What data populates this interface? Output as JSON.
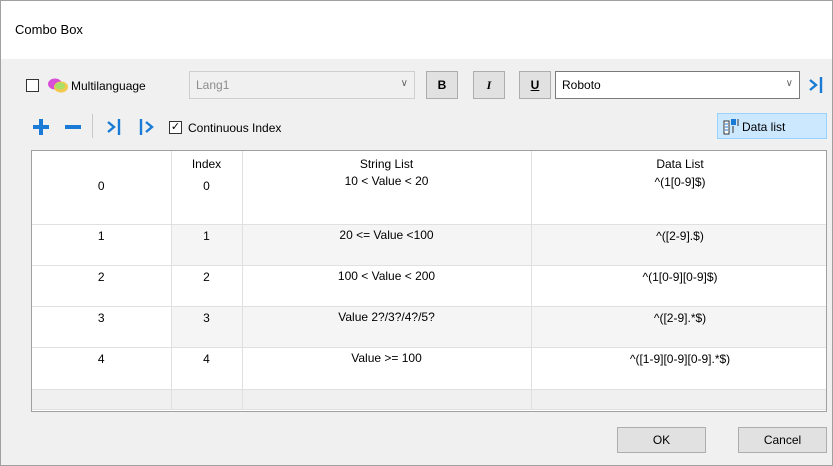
{
  "window": {
    "title": "Combo Box"
  },
  "toolbar": {
    "multilanguage_label": "Multilanguage",
    "multilanguage_checked": false,
    "language_value": "Lang1",
    "bold_label": "B",
    "italic_label": "I",
    "underline_label": "U",
    "font_value": "Roboto"
  },
  "list_toolbar": {
    "continuous_index_label": "Continuous Index",
    "continuous_index_checked": true,
    "data_list_label": "Data list"
  },
  "grid": {
    "headers": {
      "index": "Index",
      "string_list": "String List",
      "data_list": "Data List"
    },
    "rows": [
      {
        "row": "0",
        "index": "0",
        "string_list": "10 < Value < 20",
        "data_list": "^(1[0-9]$)"
      },
      {
        "row": "1",
        "index": "1",
        "string_list": "20 <= Value <100",
        "data_list": "^([2-9].$)"
      },
      {
        "row": "2",
        "index": "2",
        "string_list": "100 < Value < 200",
        "data_list": "^(1[0-9][0-9]$)"
      },
      {
        "row": "3",
        "index": "3",
        "string_list": "Value 2?/3?/4?/5?",
        "data_list": "^([2-9].*$)"
      },
      {
        "row": "4",
        "index": "4",
        "string_list": "Value >= 100",
        "data_list": "^([1-9][0-9][0-9].*$)"
      }
    ]
  },
  "footer": {
    "ok_label": "OK",
    "cancel_label": "Cancel"
  },
  "colors": {
    "accent_blue": "#1a7bd6",
    "selected_bg": "#cce8ff"
  }
}
